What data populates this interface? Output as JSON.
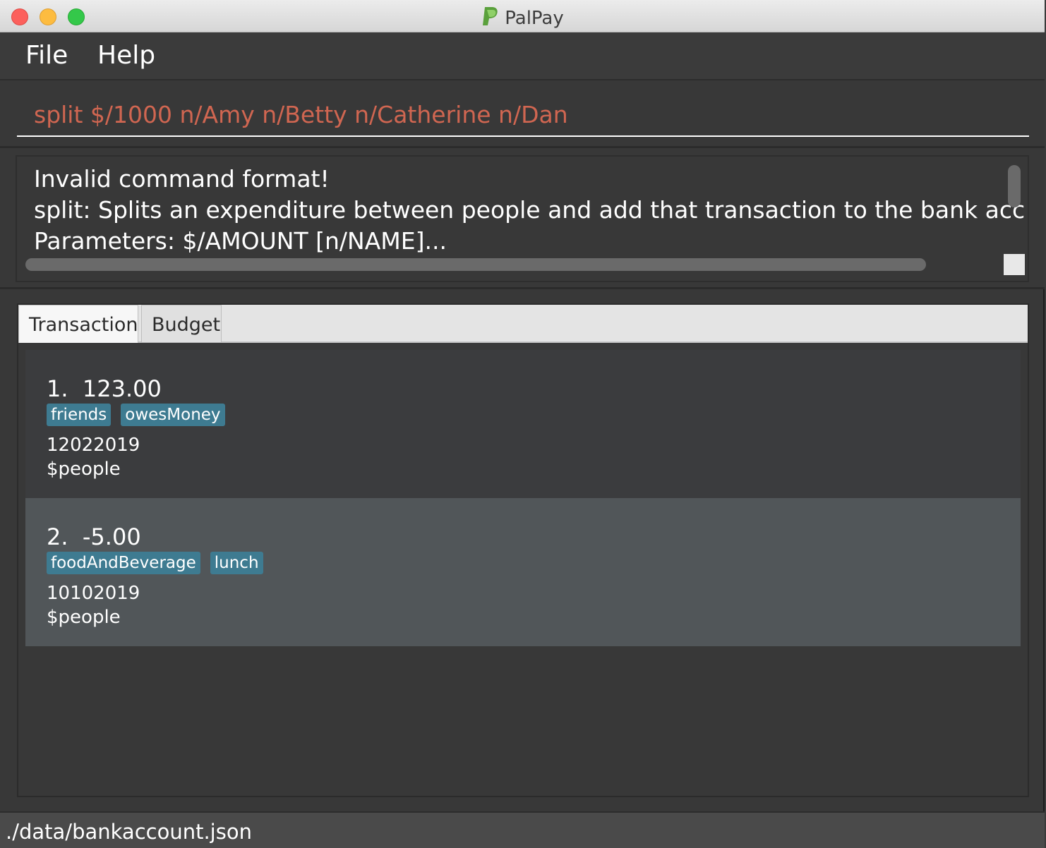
{
  "window": {
    "title": "PalPay"
  },
  "menu": {
    "items": [
      "File",
      "Help"
    ]
  },
  "command_box": {
    "value": "split $/1000 n/Amy n/Betty n/Catherine n/Dan"
  },
  "result_display": {
    "lines": [
      "Invalid command format!",
      "split: Splits an expenditure between people and add that transaction to the bank acc",
      "Parameters: $/AMOUNT [n/NAME]..."
    ]
  },
  "tabs": [
    {
      "label": "Transaction",
      "selected": true
    },
    {
      "label": "Budget",
      "selected": false
    }
  ],
  "transactions": [
    {
      "index": "1.",
      "amount": "123.00",
      "tags": [
        "friends",
        "owesMoney"
      ],
      "date": "12022019",
      "people": "$people"
    },
    {
      "index": "2.",
      "amount": "-5.00",
      "tags": [
        "foodAndBeverage",
        "lunch"
      ],
      "date": "10102019",
      "people": "$people"
    }
  ],
  "status_bar": {
    "path": "./data/bankaccount.json"
  },
  "colors": {
    "command_text": "#d06651",
    "tag_bg": "#3e7b91",
    "card_odd": "#3b3c3e",
    "card_even": "#515659"
  },
  "icons": [
    "palpay-logo-icon",
    "close-window-icon",
    "minimize-window-icon",
    "zoom-window-icon"
  ]
}
